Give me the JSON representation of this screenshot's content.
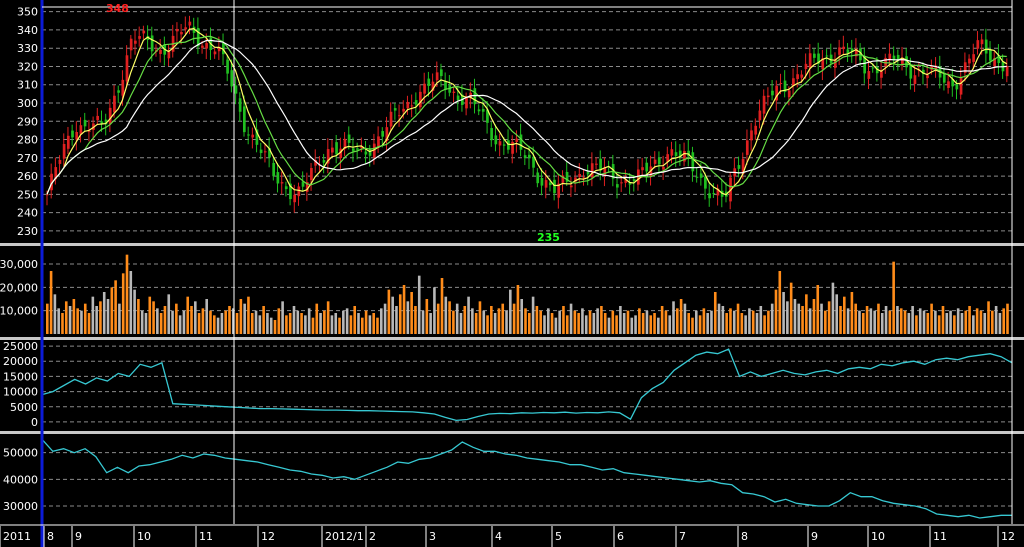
{
  "colors": {
    "background": "#000000",
    "axis": "#0b1bd8",
    "grid": "#8a8a8a",
    "separator": "#c8c8c8",
    "candle_up": "#e02020",
    "candle_down": "#20c020",
    "ma_short": "#ffff66",
    "ma_mid": "#ffffff",
    "ma_long": "#66dd44",
    "volume_up": "#ff8c1a",
    "volume_down": "#b8b8b8",
    "indicator_line": "#37c8d2"
  },
  "annotations": {
    "high_label": "348",
    "low_label": "235"
  },
  "chart_data": [
    {
      "type": "candlestick",
      "panel": "price",
      "ylim": [
        225,
        352
      ],
      "y_ticks": [
        "230",
        "240",
        "250",
        "260",
        "270",
        "280",
        "290",
        "300",
        "310",
        "320",
        "330",
        "340",
        "350"
      ],
      "grid": true,
      "moving_averages": [
        "short",
        "mid",
        "long"
      ],
      "key_points": [
        {
          "x": "2011/8",
          "close": 250
        },
        {
          "x": "2011/8 end",
          "close": 290
        },
        {
          "x": "2011/9 mid",
          "close": 285
        },
        {
          "x": "2011/9 end",
          "close": 335
        },
        {
          "x": "2011/10",
          "close": 330
        },
        {
          "x": "2011/10 end",
          "close": 340
        },
        {
          "x": "2011/11",
          "close": 330
        },
        {
          "x": "2011/11 end",
          "close": 290
        },
        {
          "x": "2011/12",
          "close": 260
        },
        {
          "x": "2011/12 mid",
          "close": 250
        },
        {
          "x": "2011/12 end",
          "close": 278
        },
        {
          "x": "2012/1",
          "close": 272
        },
        {
          "x": "2012/1 end",
          "close": 285
        },
        {
          "x": "2012/2",
          "close": 305
        },
        {
          "x": "2012/3",
          "close": 312
        },
        {
          "x": "2012/3 end",
          "close": 300
        },
        {
          "x": "2012/4",
          "close": 280
        },
        {
          "x": "2012/4 end",
          "close": 270
        },
        {
          "x": "2012/5",
          "close": 250
        },
        {
          "x": "2012/5 mid",
          "close": 265
        },
        {
          "x": "2012/6",
          "close": 260
        },
        {
          "x": "2012/6 end",
          "close": 258
        },
        {
          "x": "2012/7",
          "close": 275
        },
        {
          "x": "2012/7 end",
          "close": 262
        },
        {
          "x": "2012/8",
          "close": 245
        },
        {
          "x": "2012/8 mid",
          "close": 290
        },
        {
          "x": "2012/8 end",
          "close": 310
        },
        {
          "x": "2012/9",
          "close": 320
        },
        {
          "x": "2012/9 end",
          "close": 330
        },
        {
          "x": "2012/10",
          "close": 320
        },
        {
          "x": "2012/10 end",
          "close": 322
        },
        {
          "x": "2012/11",
          "close": 318
        },
        {
          "x": "2012/11 end",
          "close": 310
        },
        {
          "x": "2012/12",
          "close": 330
        },
        {
          "x": "2012/12 end",
          "close": 322
        }
      ],
      "high": 348,
      "low": 235
    },
    {
      "type": "bar",
      "panel": "volume",
      "ylim": [
        0,
        36000
      ],
      "y_ticks": [
        "10,000",
        "20,000",
        "30,000"
      ],
      "series": [
        {
          "values": [
            13000,
            27000,
            17000,
            11000,
            9000,
            14000,
            12000,
            15000,
            11000,
            10000,
            13000,
            9000,
            16000,
            12000,
            14000,
            18000,
            15000,
            20000,
            23000,
            13000,
            26000,
            34000,
            27000,
            19000,
            15000,
            10000,
            9000,
            16000,
            14000,
            11000,
            9000,
            12000,
            17000,
            10000,
            13000,
            8000,
            10000,
            16000,
            12000,
            14000,
            9000,
            11000,
            15000,
            10000,
            8000,
            7000,
            9000,
            10000,
            12000,
            11000,
            9000,
            15000,
            13000,
            16000,
            9000,
            10000,
            8000,
            12000,
            9000,
            7000,
            6000,
            11000,
            14000,
            8000,
            9000,
            12000,
            10000,
            9000,
            8000,
            11000,
            7000,
            13000,
            9000,
            10000,
            14000,
            8000,
            9000,
            7000,
            10000,
            11000,
            8000,
            12000,
            9000,
            7000,
            10000,
            8000,
            9000,
            7000,
            11000,
            13000,
            19000,
            16000,
            12000,
            17000,
            21000,
            14000,
            18000,
            12000,
            25000,
            10000,
            15000,
            9000,
            20000,
            13000,
            24000,
            16000,
            14000,
            10000,
            13000,
            9000,
            12000,
            16000,
            11000,
            9000,
            14000,
            10000,
            8000,
            12000,
            9000,
            11000,
            13000,
            10000,
            19000,
            13000,
            21000,
            15000,
            11000,
            9000,
            16000,
            12000,
            10000,
            8000,
            11000,
            9000,
            7000,
            10000,
            12000,
            8000,
            13000,
            10000,
            9000,
            11000,
            8000,
            10000,
            9000,
            11000,
            12000,
            9000,
            7000,
            10000,
            8000,
            12000,
            9000,
            10000,
            7000,
            8000,
            11000,
            9000,
            10000,
            8000,
            9000,
            7000,
            12000,
            10000,
            8000,
            14000,
            11000,
            15000,
            13000,
            9000,
            7000,
            10000,
            8000,
            11000,
            9000,
            10000,
            18000,
            13000,
            12000,
            9000,
            11000,
            10000,
            13000,
            9000,
            8000,
            11000,
            10000,
            9000,
            12000,
            8000,
            10000,
            13000,
            19000,
            27000,
            18000,
            14000,
            22000,
            15000,
            13000,
            12000,
            17000,
            11000,
            15000,
            21000,
            13000,
            10000,
            14000,
            22000,
            17000,
            12000,
            16000,
            11000,
            18000,
            13000,
            10000,
            9000,
            12000,
            11000,
            10000,
            13000,
            9000,
            12000,
            10000,
            31000,
            12000,
            11000,
            10000,
            9000,
            12000,
            8000,
            11000,
            10000,
            9000,
            13000,
            10000,
            8000,
            12000,
            9000,
            10000,
            8000,
            11000,
            9000,
            10000,
            12000,
            8000,
            11000,
            10000,
            9000,
            14000,
            10000,
            12000,
            9000,
            11000,
            13000
          ]
        }
      ]
    },
    {
      "type": "line",
      "panel": "indicator1",
      "ylim": [
        -2000,
        27000
      ],
      "y_ticks": [
        "0",
        "5000",
        "10000",
        "15000",
        "20000",
        "25000"
      ],
      "series": [
        {
          "values": [
            9000,
            10000,
            12000,
            14000,
            12500,
            14500,
            13500,
            16000,
            15000,
            19000,
            18000,
            19500,
            6000,
            5800,
            5600,
            5400,
            5200,
            5000,
            4800,
            4600,
            4400,
            4400,
            4300,
            4200,
            4100,
            4000,
            3900,
            3900,
            3800,
            3700,
            3700,
            3600,
            3500,
            3400,
            3300,
            3000,
            2600,
            1500,
            500,
            800,
            1800,
            2600,
            2800,
            2700,
            3000,
            2900,
            3100,
            3000,
            3200,
            2900,
            3100,
            3000,
            3300,
            3000,
            900,
            8000,
            11000,
            13000,
            17000,
            19500,
            22000,
            23000,
            22500,
            24000,
            15000,
            16500,
            15000,
            16000,
            17000,
            16000,
            15500,
            16500,
            17000,
            16000,
            17500,
            18000,
            17500,
            19000,
            18500,
            19500,
            20000,
            19000,
            20500,
            21000,
            20500,
            21500,
            22000,
            22500,
            21500,
            19500
          ]
        }
      ]
    },
    {
      "type": "line",
      "panel": "indicator2",
      "ylim": [
        24000,
        57000
      ],
      "y_ticks": [
        "30000",
        "40000",
        "50000"
      ],
      "series": [
        {
          "values": [
            55000,
            50500,
            51500,
            50000,
            51500,
            48500,
            42500,
            44500,
            42500,
            45000,
            45500,
            46500,
            47500,
            49000,
            48000,
            49500,
            49000,
            48000,
            47500,
            47000,
            46500,
            45500,
            44500,
            43500,
            43000,
            42000,
            41500,
            40500,
            41000,
            40000,
            41500,
            43000,
            44500,
            46500,
            46000,
            47500,
            48000,
            49500,
            51000,
            54000,
            52000,
            50500,
            50500,
            49500,
            49000,
            48000,
            47500,
            47000,
            46500,
            45500,
            45500,
            44500,
            43500,
            44000,
            42500,
            42000,
            41500,
            41000,
            40500,
            40000,
            39500,
            39000,
            39500,
            38500,
            38000,
            35000,
            34500,
            33500,
            31500,
            32500,
            31000,
            30500,
            30000,
            30000,
            32000,
            35000,
            33500,
            33500,
            32000,
            31000,
            30500,
            30000,
            29000,
            27000,
            26500,
            26000,
            26500,
            25500,
            26000,
            26500,
            26500
          ]
        }
      ]
    }
  ],
  "x_axis": {
    "ticks": [
      "2011",
      "8",
      "9",
      "10",
      "11",
      "12",
      "2012/1",
      "2",
      "3",
      "4",
      "5",
      "6",
      "7",
      "8",
      "9",
      "10",
      "11",
      "12"
    ]
  }
}
